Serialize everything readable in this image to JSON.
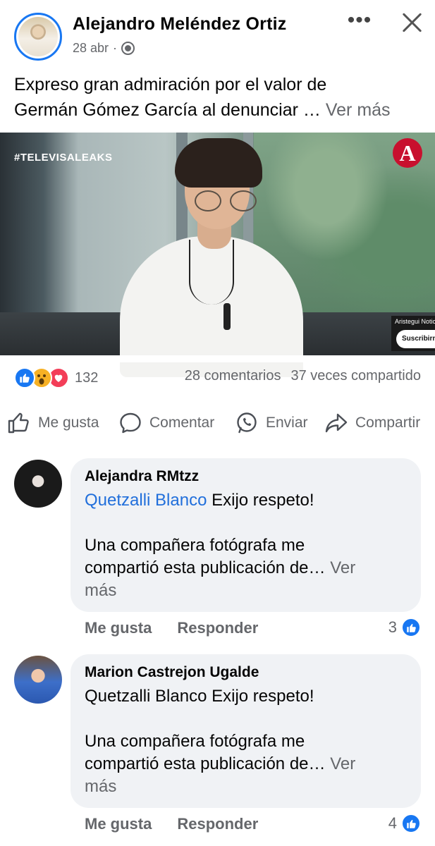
{
  "post": {
    "author": "Alejandro Meléndez Ortiz",
    "date": "28 abr",
    "separator": "·",
    "text_line1": "Expreso gran admiración por el valor de",
    "text_line2": "Germán Gómez García al denunciar …",
    "see_more": "Ver más"
  },
  "header": {
    "more_icon": "more-horizontal-icon",
    "close_icon": "close-icon",
    "more_glyph": "•••"
  },
  "media": {
    "hashtag": "#TELEVISALEAKS",
    "brand_letter": "A",
    "channel_name": "Aristegui Noticias",
    "subscribe_label": "Suscribirme"
  },
  "reactions": {
    "count": "132",
    "comments": "28 comentarios",
    "shares": "37 veces compartido",
    "types": [
      "like",
      "wow",
      "love"
    ]
  },
  "actions": {
    "like": "Me gusta",
    "comment": "Comentar",
    "send": "Enviar",
    "share": "Compartir"
  },
  "comments": [
    {
      "author": "Alejandra RMtzz",
      "mention": "Quetzalli Blanco",
      "line1_rest": " Exijo respeto!",
      "line2": "Una compañera fotógrafa me",
      "line3": "compartió esta publicación de…",
      "see_more_a": "Ver",
      "see_more_b": "más",
      "like_label": "Me gusta",
      "reply_label": "Responder",
      "likes": "3"
    },
    {
      "author": "Marion Castrejon Ugalde",
      "mention": "Quetzalli Blanco",
      "line1_rest": " Exijo respeto!",
      "line2": "Una compañera fotógrafa me",
      "line3": "compartió esta publicación de…",
      "see_more_a": "Ver",
      "see_more_b": "más",
      "like_label": "Me gusta",
      "reply_label": "Responder",
      "likes": "4"
    }
  ],
  "colors": {
    "brand_blue": "#1877f2",
    "mention_blue": "#216fdb",
    "muted": "#65676b",
    "bubble": "#f0f2f5"
  }
}
